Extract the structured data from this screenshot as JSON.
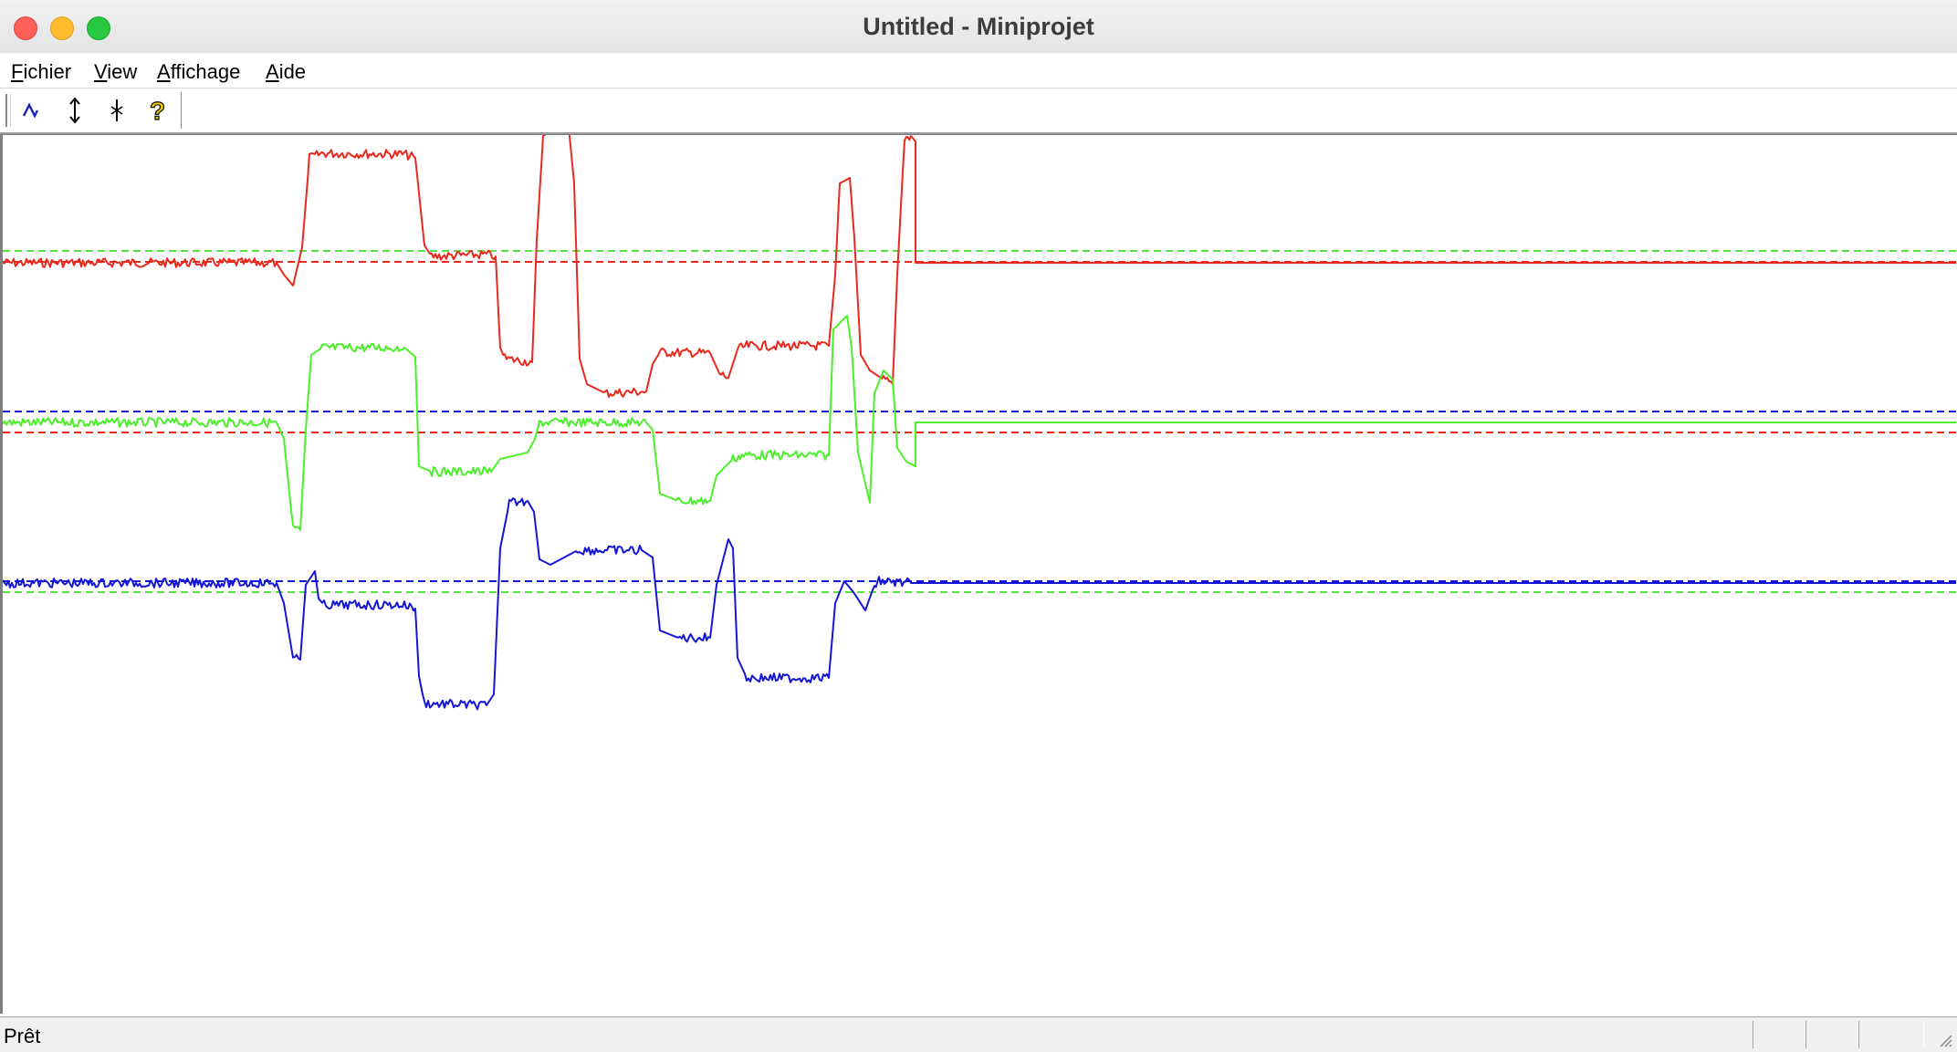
{
  "window": {
    "title": "Untitled - Miniprojet"
  },
  "menubar": {
    "items": [
      {
        "accel": "F",
        "rest": "ichier"
      },
      {
        "accel": "V",
        "rest": "iew"
      },
      {
        "accel": "A",
        "rest": "ffichage"
      },
      {
        "accel": "A",
        "rest": "ide"
      }
    ]
  },
  "toolbar": {
    "buttons": [
      "wave-icon",
      "vertical-arrows-icon",
      "cursor-marker-icon",
      "help-icon"
    ]
  },
  "plot": {
    "colors": {
      "red": "#e8291c",
      "green": "#4cf02a",
      "blue": "#1515d8",
      "green_ref": "#55e043"
    },
    "chart_data": {
      "type": "line",
      "series": [
        {
          "color": "red",
          "points": [
            [
              0,
              287
            ],
            [
              300,
              287
            ],
            [
              308,
              300
            ],
            [
              318,
              312
            ],
            [
              328,
              270
            ],
            [
              336,
              172
            ],
            [
              350,
              167
            ],
            [
              440,
              168
            ],
            [
              452,
              172
            ],
            [
              462,
              268
            ],
            [
              470,
              280
            ],
            [
              530,
              278
            ],
            [
              540,
              280
            ],
            [
              545,
              380
            ],
            [
              550,
              392
            ],
            [
              580,
              396
            ],
            [
              585,
              262
            ],
            [
              592,
              148
            ],
            [
              605,
              140
            ],
            [
              620,
              138
            ],
            [
              626,
              200
            ],
            [
              632,
              392
            ],
            [
              640,
              420
            ],
            [
              660,
              430
            ],
            [
              705,
              428
            ],
            [
              712,
              398
            ],
            [
              720,
              385
            ],
            [
              775,
              386
            ],
            [
              785,
              408
            ],
            [
              795,
              413
            ],
            [
              805,
              382
            ],
            [
              815,
              378
            ],
            [
              905,
              378
            ],
            [
              912,
              300
            ],
            [
              917,
              200
            ],
            [
              928,
              194
            ],
            [
              933,
              260
            ],
            [
              940,
              388
            ],
            [
              950,
              405
            ],
            [
              965,
              415
            ],
            [
              975,
              420
            ],
            [
              980,
              300
            ],
            [
              988,
              150
            ],
            [
              995,
              148
            ],
            [
              1000,
              154
            ],
            [
              1000,
              287
            ],
            [
              2140,
              287
            ]
          ]
        },
        {
          "color": "green",
          "points": [
            [
              0,
              462
            ],
            [
              300,
              462
            ],
            [
              308,
              480
            ],
            [
              318,
              578
            ],
            [
              326,
              580
            ],
            [
              332,
              470
            ],
            [
              338,
              388
            ],
            [
              350,
              380
            ],
            [
              440,
              380
            ],
            [
              452,
              390
            ],
            [
              456,
              510
            ],
            [
              470,
              516
            ],
            [
              535,
              516
            ],
            [
              545,
              502
            ],
            [
              575,
              495
            ],
            [
              583,
              480
            ],
            [
              588,
              462
            ],
            [
              640,
              462
            ],
            [
              705,
              462
            ],
            [
              712,
              470
            ],
            [
              720,
              540
            ],
            [
              740,
              548
            ],
            [
              775,
              548
            ],
            [
              782,
              520
            ],
            [
              800,
              502
            ],
            [
              810,
              498
            ],
            [
              905,
              498
            ],
            [
              910,
              360
            ],
            [
              925,
              345
            ],
            [
              930,
              380
            ],
            [
              937,
              495
            ],
            [
              950,
              550
            ],
            [
              955,
              430
            ],
            [
              965,
              405
            ],
            [
              975,
              415
            ],
            [
              980,
              490
            ],
            [
              990,
              505
            ],
            [
              1000,
              510
            ],
            [
              1000,
              462
            ],
            [
              2140,
              462
            ]
          ]
        },
        {
          "color": "blue",
          "points": [
            [
              0,
              638
            ],
            [
              300,
              638
            ],
            [
              308,
              660
            ],
            [
              318,
              720
            ],
            [
              326,
              722
            ],
            [
              332,
              640
            ],
            [
              342,
              625
            ],
            [
              346,
              655
            ],
            [
              352,
              662
            ],
            [
              440,
              662
            ],
            [
              452,
              666
            ],
            [
              456,
              740
            ],
            [
              462,
              770
            ],
            [
              530,
              772
            ],
            [
              538,
              760
            ],
            [
              545,
              600
            ],
            [
              555,
              550
            ],
            [
              575,
              548
            ],
            [
              582,
              560
            ],
            [
              588,
              612
            ],
            [
              600,
              618
            ],
            [
              630,
              602
            ],
            [
              700,
              602
            ],
            [
              712,
              610
            ],
            [
              720,
              690
            ],
            [
              740,
              698
            ],
            [
              775,
              698
            ],
            [
              782,
              640
            ],
            [
              795,
              590
            ],
            [
              800,
              600
            ],
            [
              805,
              720
            ],
            [
              815,
              742
            ],
            [
              905,
              742
            ],
            [
              912,
              660
            ],
            [
              922,
              636
            ],
            [
              932,
              648
            ],
            [
              945,
              668
            ],
            [
              955,
              640
            ],
            [
              960,
              636
            ],
            [
              995,
              638
            ],
            [
              2140,
              638
            ]
          ]
        }
      ],
      "reference_lines": [
        {
          "color": "green_ref",
          "y": 274
        },
        {
          "color": "red",
          "y": 286
        },
        {
          "color": "blue",
          "y": 450
        },
        {
          "color": "red",
          "y": 473
        },
        {
          "color": "blue",
          "y": 636
        },
        {
          "color": "green_ref",
          "y": 648
        }
      ],
      "view": {
        "width": 2144,
        "height": 964,
        "y_offset": 147
      }
    }
  },
  "statusbar": {
    "text": "Prêt"
  }
}
